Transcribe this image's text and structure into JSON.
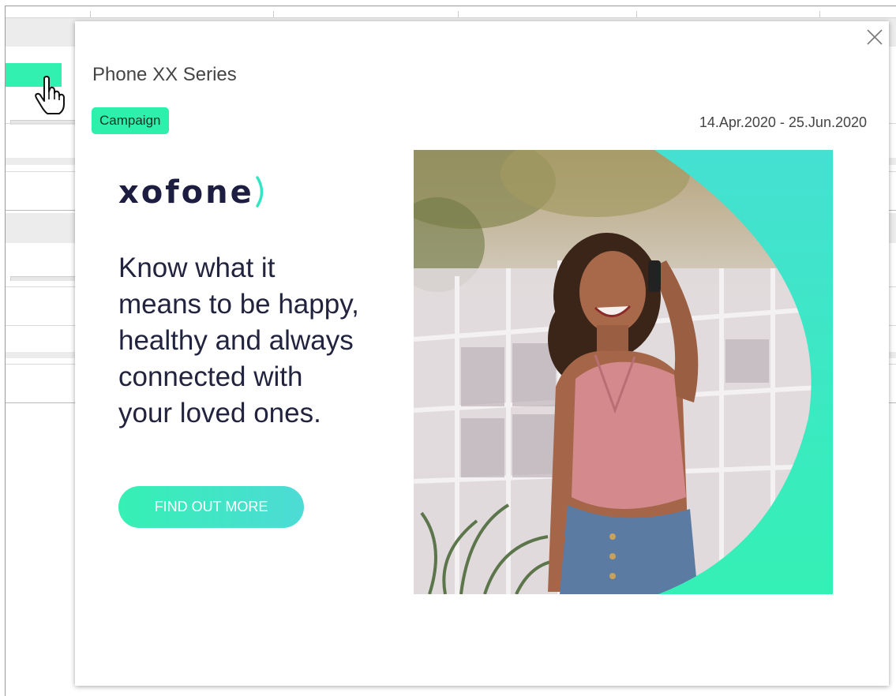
{
  "popup": {
    "title": "Phone XX Series",
    "tag": "Campaign",
    "dates": "14.Apr.2020 - 25.Jun.2020"
  },
  "ad": {
    "brand": "xofone",
    "headline_lines": [
      "Know what it",
      "means to be happy,",
      "healthy and always",
      "connected with",
      "your loved ones."
    ],
    "cta_label": "FIND OUT MORE"
  },
  "icons": {
    "close": "close-icon",
    "cursor": "hand-cursor-icon"
  },
  "colors": {
    "accent": "#2ef0ad",
    "brand_text": "#1d1d42",
    "cta_gradient_start": "#35f0b3",
    "cta_gradient_end": "#4ddbd6"
  }
}
